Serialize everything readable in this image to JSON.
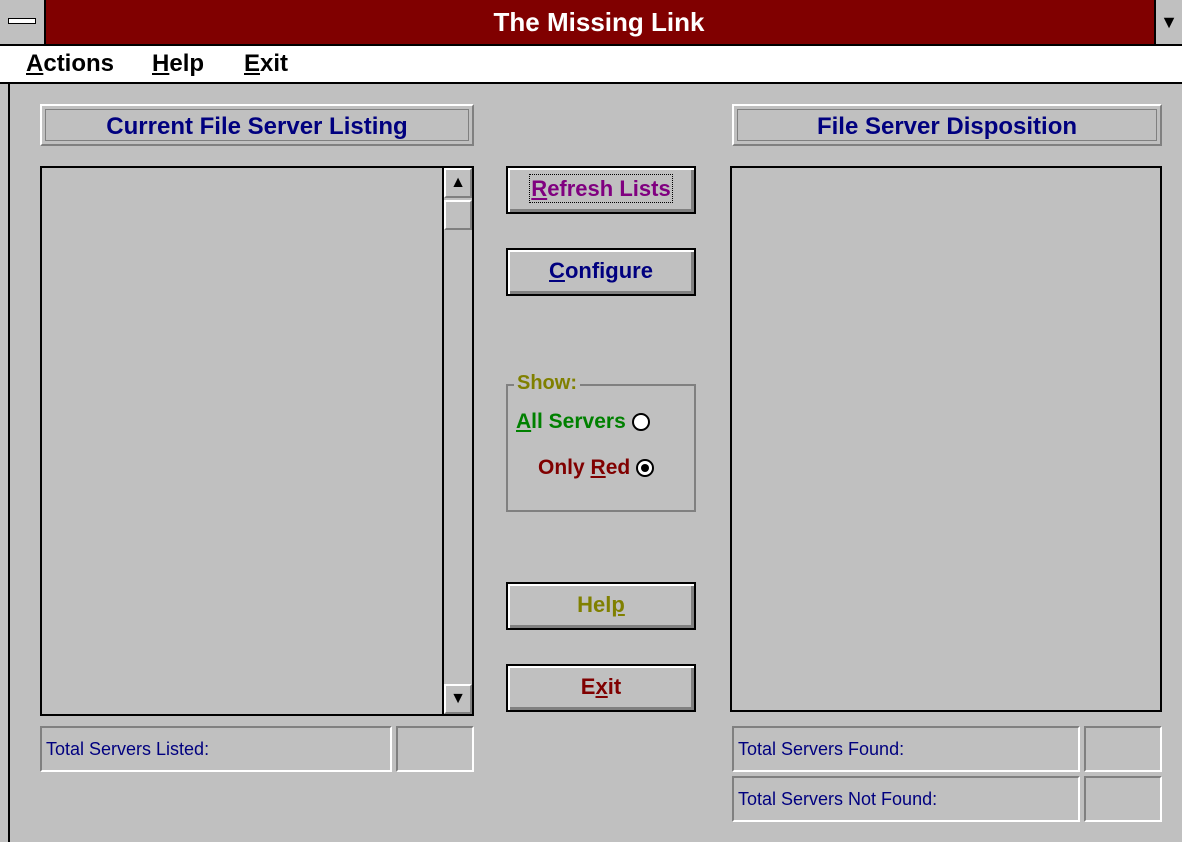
{
  "window": {
    "title": "The Missing Link"
  },
  "menu": {
    "items": [
      "Actions",
      "Help",
      "Exit"
    ]
  },
  "left_panel": {
    "header": "Current File Server Listing",
    "total_label": "Total Servers Listed:",
    "total_value": ""
  },
  "right_panel": {
    "header": "File Server Disposition",
    "found_label": "Total Servers Found:",
    "found_value": "",
    "not_found_label": "Total Servers Not Found:",
    "not_found_value": ""
  },
  "buttons": {
    "refresh": {
      "first": "R",
      "rest": "efresh Lists",
      "color": "#800080"
    },
    "configure": {
      "first": "C",
      "rest": "onfigure",
      "color": "#00007f"
    },
    "help": {
      "pre": "Hel",
      "first": "p",
      "rest": "",
      "color": "#808000"
    },
    "exit": {
      "pre": "E",
      "first": "x",
      "rest": "it",
      "color": "#800000"
    }
  },
  "show": {
    "label": "Show:",
    "all": {
      "first": "A",
      "rest": "ll Servers",
      "selected": false,
      "color": "#008000"
    },
    "red": {
      "pre": "Only ",
      "first": "R",
      "rest": "ed",
      "selected": true,
      "color": "#800000"
    }
  },
  "icons": {
    "scroll_up": "up-arrow-icon",
    "scroll_down": "down-arrow-icon"
  }
}
